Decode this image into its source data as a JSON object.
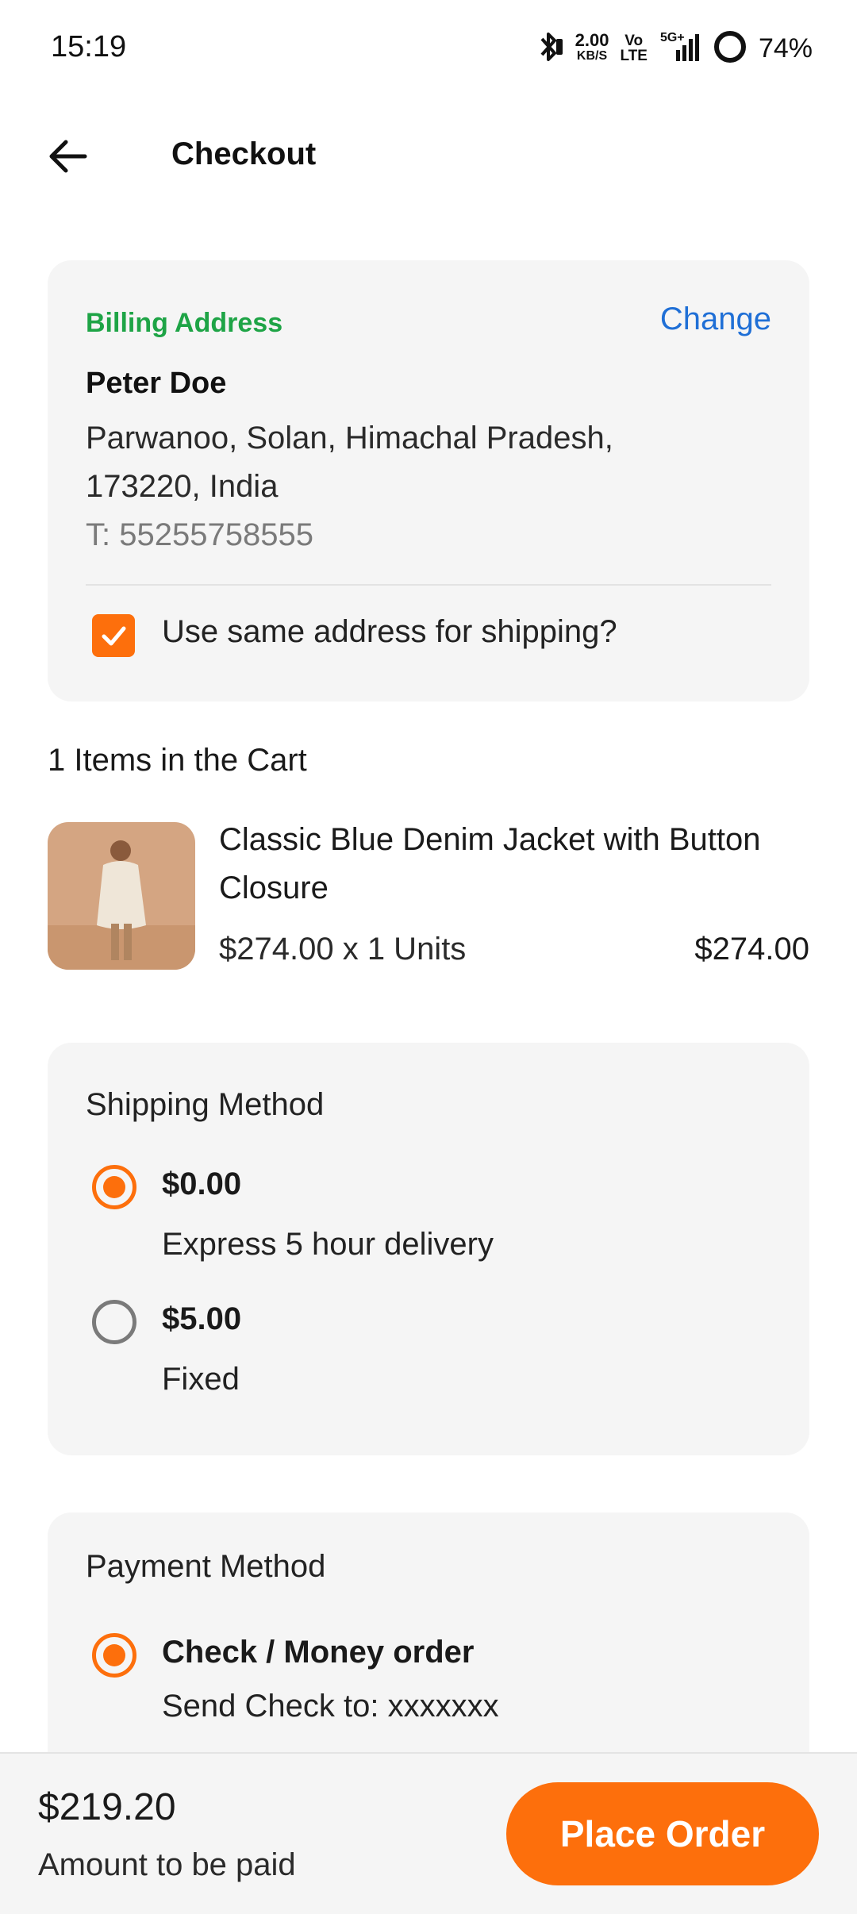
{
  "status_bar": {
    "time": "15:19",
    "network_speed_value": "2.00",
    "network_speed_unit": "KB/S",
    "volte_top": "Vo",
    "volte_bottom": "LTE",
    "signal_label": "5G+",
    "battery_percent": "74%",
    "icons": [
      "bluetooth-icon",
      "signal-icon",
      "battery-ring-icon"
    ]
  },
  "header": {
    "title": "Checkout",
    "back_icon": "arrow-left-icon"
  },
  "billing": {
    "label": "Billing Address",
    "change_label": "Change",
    "name": "Peter Doe",
    "address": "Parwanoo, Solan, Himachal Pradesh, 173220, India",
    "phone": "T: 55255758555",
    "same_address_label": "Use same address for shipping?",
    "same_address_checked": true
  },
  "cart": {
    "title": "1 Items in the Cart",
    "items": [
      {
        "name": "Classic Blue Denim Jacket with Button Closure",
        "qty_line": "$274.00 x 1 Units",
        "total": "$274.00"
      }
    ]
  },
  "shipping": {
    "title": "Shipping Method",
    "options": [
      {
        "price": "$0.00",
        "description": "Express 5 hour delivery",
        "selected": true
      },
      {
        "price": "$5.00",
        "description": "Fixed",
        "selected": false
      }
    ]
  },
  "payment": {
    "title": "Payment Method",
    "options": [
      {
        "name": "Check / Money order",
        "description": "Send Check to: xxxxxxx",
        "selected": true
      }
    ]
  },
  "footer": {
    "amount": "$219.20",
    "amount_label": "Amount to be paid",
    "place_order_label": "Place Order"
  },
  "colors": {
    "accent": "#fd6f0c",
    "billing_label": "#1ea446",
    "link": "#1f6fd6",
    "card_bg": "#f5f5f5"
  }
}
